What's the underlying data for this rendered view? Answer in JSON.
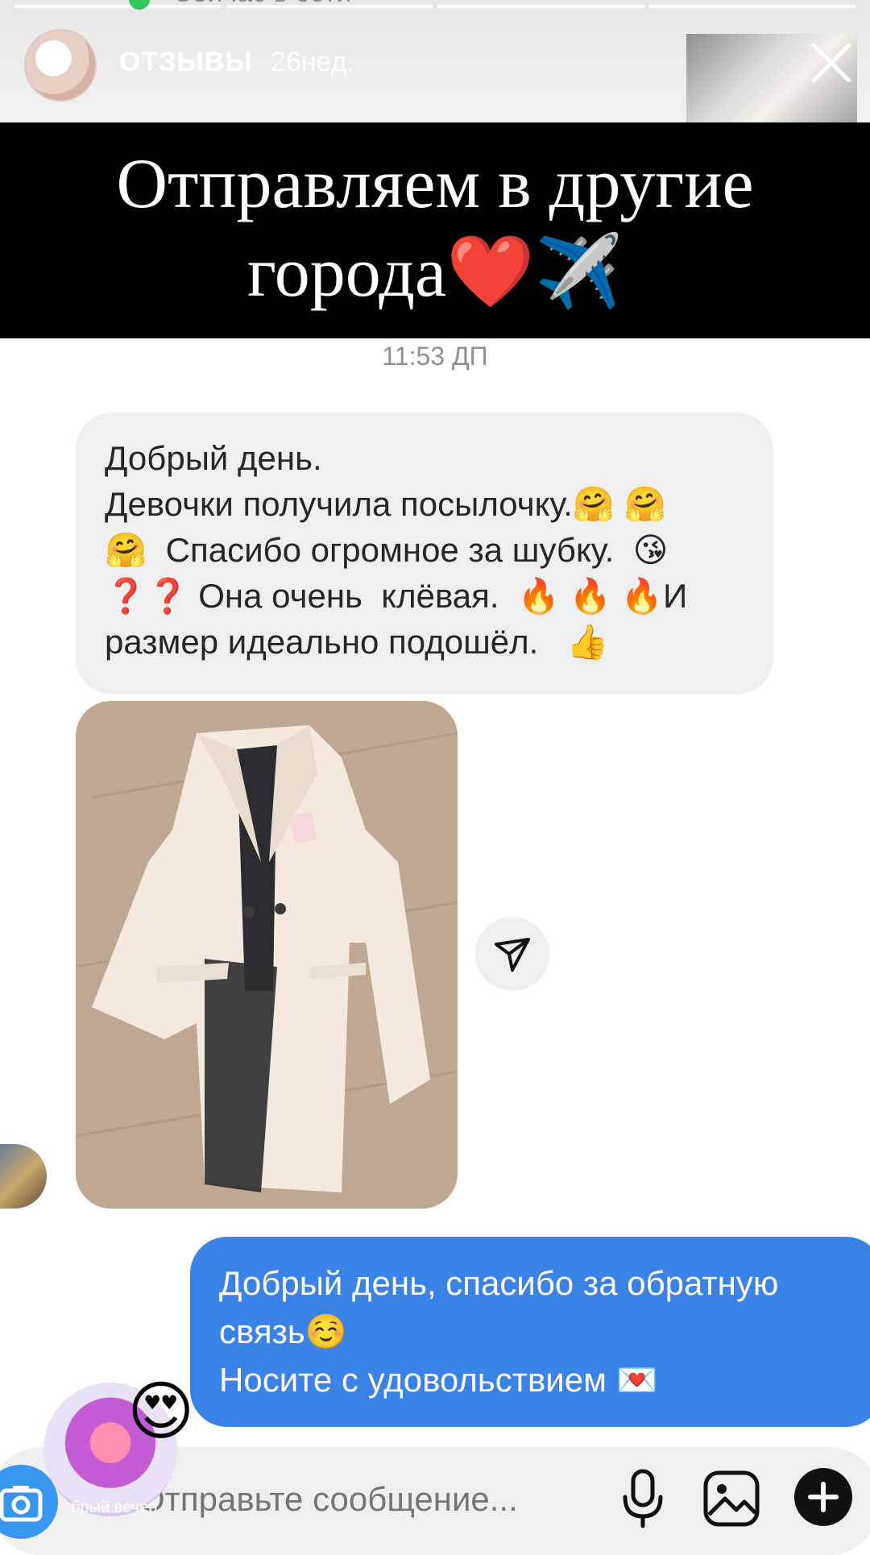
{
  "story": {
    "title": "ОТЗЫВЫ",
    "time": "26нед.",
    "hidden_status": "Сейчас в сети"
  },
  "banner": {
    "line1": "Отправляем в другие",
    "line2": "города❤️✈️"
  },
  "chat": {
    "timestamp": "11:53 ДП",
    "incoming_message": "Добрый день.\nДевочки получила посылочку.🤗 🤗\n🤗  Спасибо огромное за шубку.  😘\n❓❓ Она очень  клёвая.  🔥 🔥 🔥И\nразмер идеально подошёл.   👍",
    "outgoing_message": "Добрый день, спасибо за обратную\nсвязь☺️\nНосите с удовольствием 💌",
    "reaction_emoji": "😍",
    "reaction_caption": "брый вечер"
  },
  "composer": {
    "placeholder": "Отправьте сообщение..."
  },
  "colors": {
    "outgoing_bubble": "#3a82e6",
    "incoming_bubble": "#efefef",
    "camera_button": "#3797f0"
  },
  "icons": [
    "close-icon",
    "share-icon",
    "camera-icon",
    "mic-icon",
    "gallery-icon",
    "plus-icon"
  ]
}
